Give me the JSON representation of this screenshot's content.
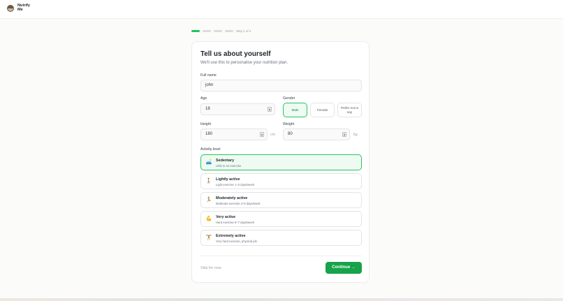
{
  "app": {
    "name_line1": "Nutrify",
    "name_line2": "Me"
  },
  "progress": {
    "step_label": "Step 1 of 4",
    "current_step": 1,
    "total_steps": 4,
    "accent": "#22c55e"
  },
  "form": {
    "title": "Tell us about yourself",
    "subtitle": "We'll use this to personalise your nutrition plan.",
    "full_name": {
      "label": "Full name",
      "value": "john"
    },
    "age": {
      "label": "Age",
      "value": "18"
    },
    "gender": {
      "label": "Gender",
      "options": [
        "Male",
        "Female",
        "Prefer not to say"
      ],
      "selected": "Male"
    },
    "height": {
      "label": "Height",
      "value": "180",
      "unit": "cm"
    },
    "weight": {
      "label": "Weight",
      "value": "80",
      "unit": "kg"
    },
    "activity": {
      "label": "Activity level",
      "selected": "Sedentary",
      "options": [
        {
          "title": "Sedentary",
          "desc": "Little to no exercise",
          "icon": "🛋️"
        },
        {
          "title": "Lightly active",
          "desc": "Light exercise 1–3 days/week",
          "icon": "🚶"
        },
        {
          "title": "Moderately active",
          "desc": "Moderate exercise 3–5 days/week",
          "icon": "🏃"
        },
        {
          "title": "Very active",
          "desc": "Hard exercise 6–7 days/week",
          "icon": "💪"
        },
        {
          "title": "Extremely active",
          "desc": "Very hard exercise, physical job",
          "icon": "🏋️"
        }
      ]
    },
    "skip_label": "Skip for now",
    "continue_label": "Continue →"
  },
  "colors": {
    "primary": "#16a34a",
    "selected_bg": "#effbf2"
  }
}
